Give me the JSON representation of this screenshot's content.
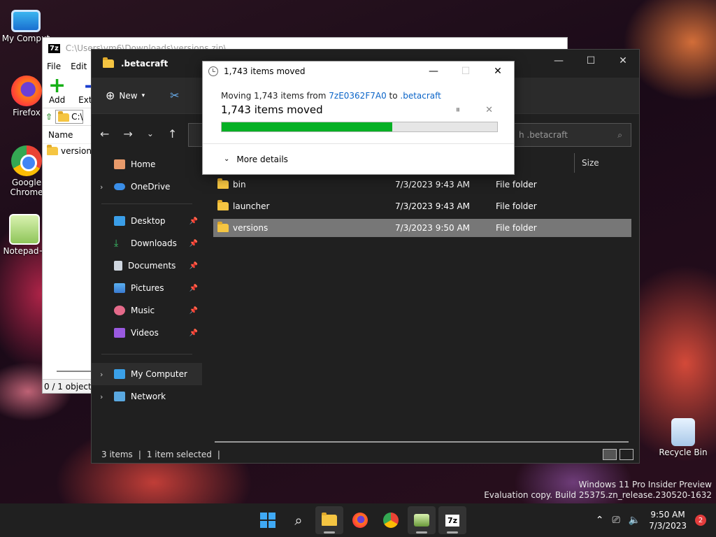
{
  "desktop": {
    "icons": [
      {
        "label": "My Comput"
      },
      {
        "label": "Firefox"
      },
      {
        "label": "Google Chrome"
      },
      {
        "label": "Notepad+"
      },
      {
        "label": "Recycle Bin"
      }
    ]
  },
  "zip_window": {
    "title": "C:\\Users\\vm6\\Downloads\\versions.zip\\",
    "logo": "7z",
    "menu": [
      "File",
      "Edit"
    ],
    "toolbar": {
      "add": "Add",
      "extract": "Extra"
    },
    "address": "C:\\",
    "column_name": "Name",
    "row": "versions",
    "status": "0 / 1 object(s"
  },
  "explorer": {
    "title": ".betacraft",
    "new_label": "New",
    "search_placeholder": "h .betacraft",
    "column_size": "Size",
    "nav": {
      "home": "Home",
      "onedrive": "OneDrive",
      "desktop": "Desktop",
      "downloads": "Downloads",
      "documents": "Documents",
      "pictures": "Pictures",
      "music": "Music",
      "videos": "Videos",
      "my_computer": "My Computer",
      "network": "Network"
    },
    "files": [
      {
        "name": "bin",
        "date": "7/3/2023 9:43 AM",
        "type": "File folder"
      },
      {
        "name": "launcher",
        "date": "7/3/2023 9:43 AM",
        "type": "File folder"
      },
      {
        "name": "versions",
        "date": "7/3/2023 9:50 AM",
        "type": "File folder"
      }
    ],
    "status_items": "3 items",
    "status_selected": "1 item selected"
  },
  "progress_dialog": {
    "title": "1,743 items moved",
    "from_prefix": "Moving 1,743 items from ",
    "from_src": "7zE0362F7A0",
    "from_mid": " to ",
    "from_dst": ".betacraft",
    "headline": "1,743 items moved",
    "progress_percent": 62,
    "more_details": "More details"
  },
  "taskbar": {
    "time": "9:50 AM",
    "date": "7/3/2023",
    "notification_count": "2"
  },
  "watermark": {
    "line1": "Windows 11 Pro Insider Preview",
    "line2": "Evaluation copy. Build 25375.zn_release.230520-1632"
  },
  "colors": {
    "progress_fill": "#06b025",
    "link": "#0a64c8"
  }
}
